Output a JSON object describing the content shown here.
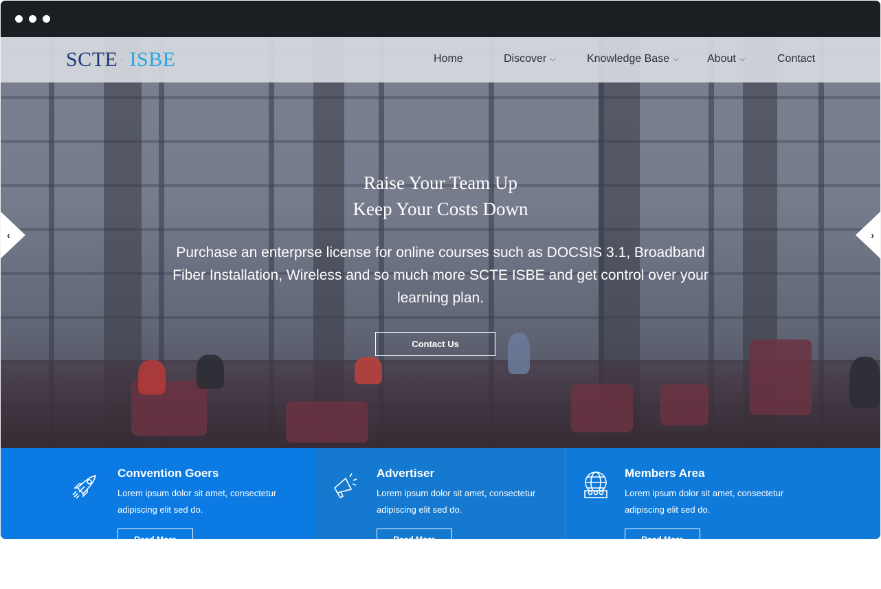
{
  "brand": {
    "scte": "SCTE",
    "separator": "·",
    "isbe": "ISBE"
  },
  "nav": {
    "items": [
      {
        "label": "Home",
        "dropdown": false
      },
      {
        "label": "Discover",
        "dropdown": true
      },
      {
        "label": "Knowledge Base",
        "dropdown": true
      },
      {
        "label": "About",
        "dropdown": true
      },
      {
        "label": "Contact",
        "dropdown": false
      }
    ],
    "chevron_glyph": "⌵"
  },
  "hero": {
    "title_line1": "Raise Your Team Up",
    "title_line2": "Keep Your Costs Down",
    "subtitle": "Purchase an enterprse license for online courses such as DOCSIS 3.1, Broadband Fiber Installation, Wireless and so much more SCTE ISBE and get control over your learning plan.",
    "cta_label": "Contact Us"
  },
  "slider": {
    "prev_glyph": "‹",
    "next_glyph": "›"
  },
  "features": [
    {
      "icon": "rocket-icon",
      "title": "Convention Goers",
      "description": "Lorem ipsum dolor sit amet, consectetur adipiscing elit sed do.",
      "button": "Read More"
    },
    {
      "icon": "megaphone-icon",
      "title": "Advertiser",
      "description": "Lorem ipsum dolor sit amet, consectetur adipiscing elit sed do.",
      "button": "Read More"
    },
    {
      "icon": "globe-people-icon",
      "title": "Members Area",
      "description": "Lorem ipsum dolor sit amet, consectetur adipiscing elit sed do.",
      "button": "Read More"
    }
  ],
  "colors": {
    "feature_blue": "#0b7ae3",
    "logo_navy": "#1f3d7a",
    "logo_cyan": "#29a7e1",
    "titlebar": "#1b1e22"
  }
}
